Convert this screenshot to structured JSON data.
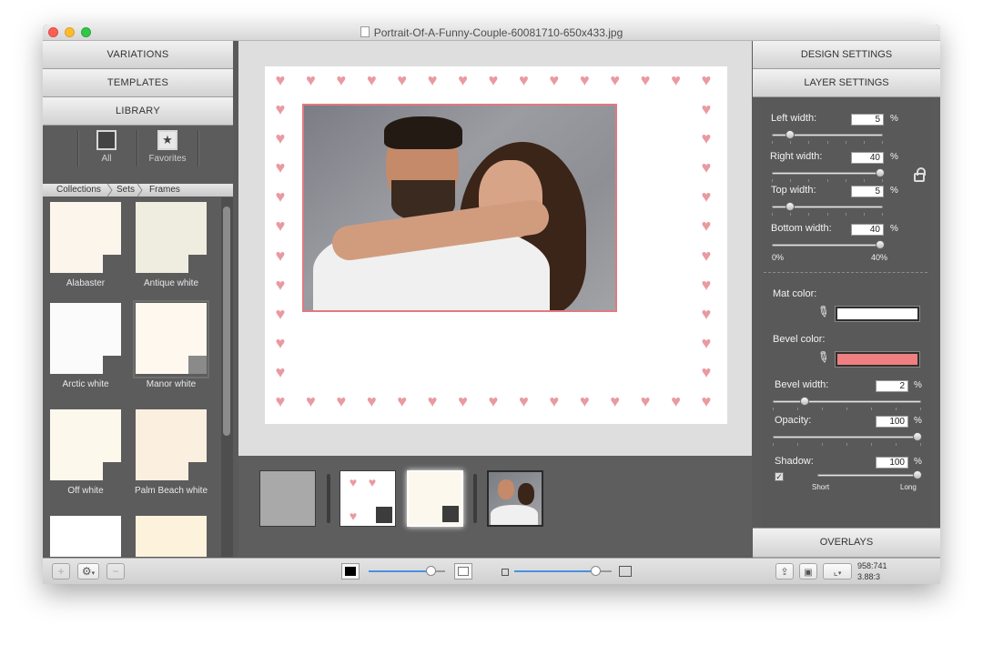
{
  "window": {
    "title": "Portrait-Of-A-Funny-Couple-60081710-650x433.jpg"
  },
  "left_panel": {
    "sections": [
      "VARIATIONS",
      "TEMPLATES",
      "LIBRARY"
    ],
    "library_buttons": [
      {
        "label": "All",
        "icon": "frame-icon"
      },
      {
        "label": "Favorites",
        "icon": "star-icon"
      }
    ],
    "breadcrumbs": [
      "Collections",
      "Sets",
      "Frames"
    ],
    "tiles": [
      {
        "label": "Alabaster",
        "color": "#fbf5ec"
      },
      {
        "label": "Antique white",
        "color": "#eeede0"
      },
      {
        "label": "Arctic white",
        "color": "#fbfbfb"
      },
      {
        "label": "Manor white",
        "color": "#fef8ee",
        "selected": true
      },
      {
        "label": "Off white",
        "color": "#fcf8ec"
      },
      {
        "label": "Palm Beach white",
        "color": "#fbefe0"
      },
      {
        "label": "",
        "color": "#ffffff"
      },
      {
        "label": "",
        "color": "#fdf2dc"
      }
    ]
  },
  "right_panel": {
    "sections": [
      "DESIGN SETTINGS",
      "LAYER SETTINGS",
      "OVERLAYS"
    ],
    "left_width": {
      "label": "Left width:",
      "value": "5",
      "unit": "%",
      "fraction": 0.125
    },
    "right_width": {
      "label": "Right width:",
      "value": "40",
      "unit": "%",
      "fraction": 1.0
    },
    "top_width": {
      "label": "Top width:",
      "value": "5",
      "unit": "%",
      "fraction": 0.125
    },
    "bottom_width": {
      "label": "Bottom width:",
      "value": "40",
      "unit": "%",
      "fraction": 1.0
    },
    "range_min": "0%",
    "range_max": "40%",
    "mat_color": {
      "label": "Mat color:",
      "color": "#ffffff"
    },
    "bevel_color": {
      "label": "Bevel color:",
      "color": "#ef7f80"
    },
    "bevel_width": {
      "label": "Bevel width:",
      "value": "2",
      "unit": "%",
      "fraction": 0.2
    },
    "opacity": {
      "label": "Opacity:",
      "value": "100",
      "unit": "%",
      "fraction": 1.0
    },
    "shadow": {
      "label": "Shadow:",
      "value": "100",
      "unit": "%",
      "fraction": 1.0,
      "checked": true,
      "short_label": "Short",
      "long_label": "Long"
    }
  },
  "bottom_bar": {
    "add": "+",
    "remove": "−",
    "gear": "⚙",
    "zoom_fraction": 0.82,
    "size_fraction": 0.85,
    "coords": "958:741",
    "ratio": "3.88:3"
  },
  "colors": {
    "accent": "#4a90e2",
    "heart": "#e99aa0",
    "bevel": "#e07a80"
  }
}
